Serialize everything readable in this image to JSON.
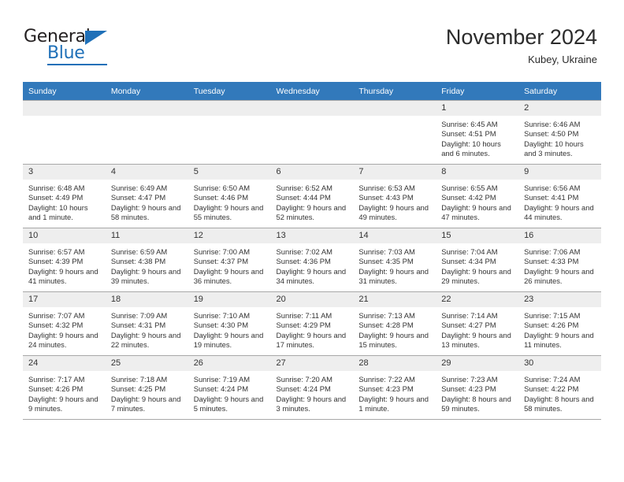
{
  "brand": {
    "name_top": "General",
    "name_bottom": "Blue",
    "accent_color": "#1f70b8"
  },
  "header": {
    "title": "November 2024",
    "subtitle": "Kubey, Ukraine"
  },
  "calendar": {
    "header_bg": "#3279bb",
    "daynum_bg": "#eeeeee",
    "weekday_headers": [
      "Sunday",
      "Monday",
      "Tuesday",
      "Wednesday",
      "Thursday",
      "Friday",
      "Saturday"
    ],
    "weeks": [
      [
        {
          "day": "",
          "sunrise": "",
          "sunset": "",
          "daylight": "",
          "empty": true
        },
        {
          "day": "",
          "sunrise": "",
          "sunset": "",
          "daylight": "",
          "empty": true
        },
        {
          "day": "",
          "sunrise": "",
          "sunset": "",
          "daylight": "",
          "empty": true
        },
        {
          "day": "",
          "sunrise": "",
          "sunset": "",
          "daylight": "",
          "empty": true
        },
        {
          "day": "",
          "sunrise": "",
          "sunset": "",
          "daylight": "",
          "empty": true
        },
        {
          "day": "1",
          "sunrise": "Sunrise: 6:45 AM",
          "sunset": "Sunset: 4:51 PM",
          "daylight": "Daylight: 10 hours and 6 minutes."
        },
        {
          "day": "2",
          "sunrise": "Sunrise: 6:46 AM",
          "sunset": "Sunset: 4:50 PM",
          "daylight": "Daylight: 10 hours and 3 minutes."
        }
      ],
      [
        {
          "day": "3",
          "sunrise": "Sunrise: 6:48 AM",
          "sunset": "Sunset: 4:49 PM",
          "daylight": "Daylight: 10 hours and 1 minute."
        },
        {
          "day": "4",
          "sunrise": "Sunrise: 6:49 AM",
          "sunset": "Sunset: 4:47 PM",
          "daylight": "Daylight: 9 hours and 58 minutes."
        },
        {
          "day": "5",
          "sunrise": "Sunrise: 6:50 AM",
          "sunset": "Sunset: 4:46 PM",
          "daylight": "Daylight: 9 hours and 55 minutes."
        },
        {
          "day": "6",
          "sunrise": "Sunrise: 6:52 AM",
          "sunset": "Sunset: 4:44 PM",
          "daylight": "Daylight: 9 hours and 52 minutes."
        },
        {
          "day": "7",
          "sunrise": "Sunrise: 6:53 AM",
          "sunset": "Sunset: 4:43 PM",
          "daylight": "Daylight: 9 hours and 49 minutes."
        },
        {
          "day": "8",
          "sunrise": "Sunrise: 6:55 AM",
          "sunset": "Sunset: 4:42 PM",
          "daylight": "Daylight: 9 hours and 47 minutes."
        },
        {
          "day": "9",
          "sunrise": "Sunrise: 6:56 AM",
          "sunset": "Sunset: 4:41 PM",
          "daylight": "Daylight: 9 hours and 44 minutes."
        }
      ],
      [
        {
          "day": "10",
          "sunrise": "Sunrise: 6:57 AM",
          "sunset": "Sunset: 4:39 PM",
          "daylight": "Daylight: 9 hours and 41 minutes."
        },
        {
          "day": "11",
          "sunrise": "Sunrise: 6:59 AM",
          "sunset": "Sunset: 4:38 PM",
          "daylight": "Daylight: 9 hours and 39 minutes."
        },
        {
          "day": "12",
          "sunrise": "Sunrise: 7:00 AM",
          "sunset": "Sunset: 4:37 PM",
          "daylight": "Daylight: 9 hours and 36 minutes."
        },
        {
          "day": "13",
          "sunrise": "Sunrise: 7:02 AM",
          "sunset": "Sunset: 4:36 PM",
          "daylight": "Daylight: 9 hours and 34 minutes."
        },
        {
          "day": "14",
          "sunrise": "Sunrise: 7:03 AM",
          "sunset": "Sunset: 4:35 PM",
          "daylight": "Daylight: 9 hours and 31 minutes."
        },
        {
          "day": "15",
          "sunrise": "Sunrise: 7:04 AM",
          "sunset": "Sunset: 4:34 PM",
          "daylight": "Daylight: 9 hours and 29 minutes."
        },
        {
          "day": "16",
          "sunrise": "Sunrise: 7:06 AM",
          "sunset": "Sunset: 4:33 PM",
          "daylight": "Daylight: 9 hours and 26 minutes."
        }
      ],
      [
        {
          "day": "17",
          "sunrise": "Sunrise: 7:07 AM",
          "sunset": "Sunset: 4:32 PM",
          "daylight": "Daylight: 9 hours and 24 minutes."
        },
        {
          "day": "18",
          "sunrise": "Sunrise: 7:09 AM",
          "sunset": "Sunset: 4:31 PM",
          "daylight": "Daylight: 9 hours and 22 minutes."
        },
        {
          "day": "19",
          "sunrise": "Sunrise: 7:10 AM",
          "sunset": "Sunset: 4:30 PM",
          "daylight": "Daylight: 9 hours and 19 minutes."
        },
        {
          "day": "20",
          "sunrise": "Sunrise: 7:11 AM",
          "sunset": "Sunset: 4:29 PM",
          "daylight": "Daylight: 9 hours and 17 minutes."
        },
        {
          "day": "21",
          "sunrise": "Sunrise: 7:13 AM",
          "sunset": "Sunset: 4:28 PM",
          "daylight": "Daylight: 9 hours and 15 minutes."
        },
        {
          "day": "22",
          "sunrise": "Sunrise: 7:14 AM",
          "sunset": "Sunset: 4:27 PM",
          "daylight": "Daylight: 9 hours and 13 minutes."
        },
        {
          "day": "23",
          "sunrise": "Sunrise: 7:15 AM",
          "sunset": "Sunset: 4:26 PM",
          "daylight": "Daylight: 9 hours and 11 minutes."
        }
      ],
      [
        {
          "day": "24",
          "sunrise": "Sunrise: 7:17 AM",
          "sunset": "Sunset: 4:26 PM",
          "daylight": "Daylight: 9 hours and 9 minutes."
        },
        {
          "day": "25",
          "sunrise": "Sunrise: 7:18 AM",
          "sunset": "Sunset: 4:25 PM",
          "daylight": "Daylight: 9 hours and 7 minutes."
        },
        {
          "day": "26",
          "sunrise": "Sunrise: 7:19 AM",
          "sunset": "Sunset: 4:24 PM",
          "daylight": "Daylight: 9 hours and 5 minutes."
        },
        {
          "day": "27",
          "sunrise": "Sunrise: 7:20 AM",
          "sunset": "Sunset: 4:24 PM",
          "daylight": "Daylight: 9 hours and 3 minutes."
        },
        {
          "day": "28",
          "sunrise": "Sunrise: 7:22 AM",
          "sunset": "Sunset: 4:23 PM",
          "daylight": "Daylight: 9 hours and 1 minute."
        },
        {
          "day": "29",
          "sunrise": "Sunrise: 7:23 AM",
          "sunset": "Sunset: 4:23 PM",
          "daylight": "Daylight: 8 hours and 59 minutes."
        },
        {
          "day": "30",
          "sunrise": "Sunrise: 7:24 AM",
          "sunset": "Sunset: 4:22 PM",
          "daylight": "Daylight: 8 hours and 58 minutes."
        }
      ]
    ]
  }
}
